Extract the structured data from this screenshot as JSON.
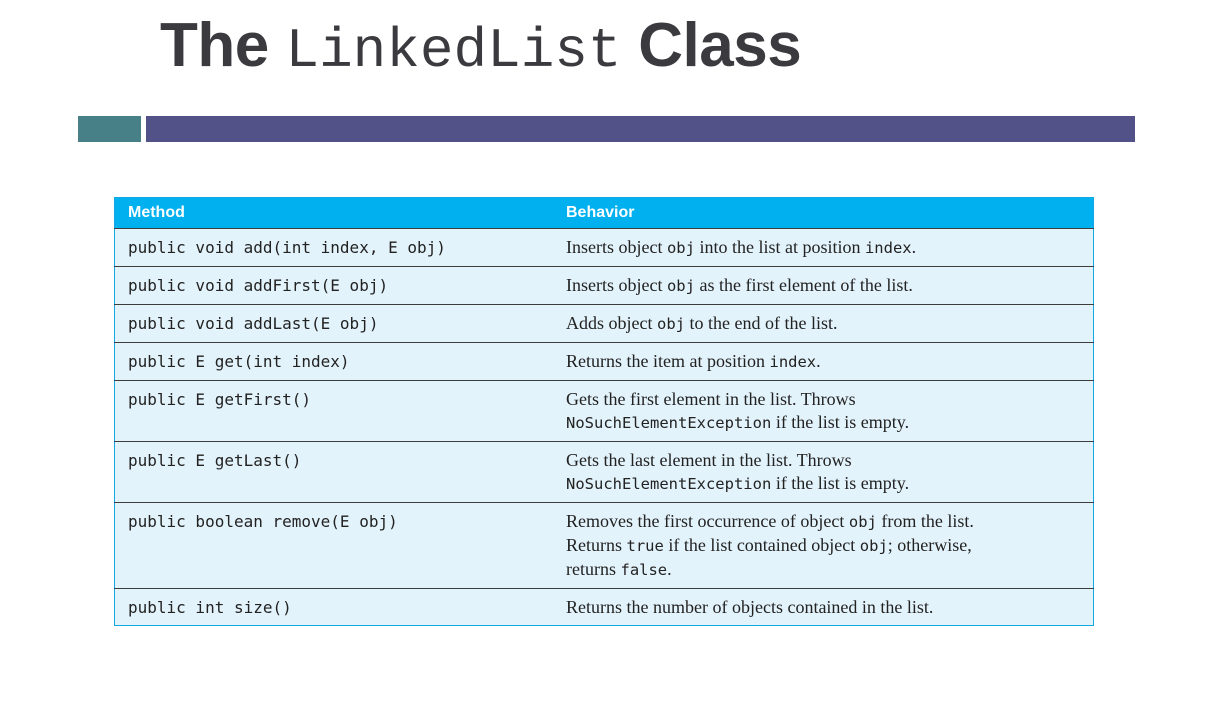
{
  "title": {
    "prefix": "The",
    "code": "LinkedList",
    "suffix": "Class"
  },
  "table": {
    "headers": {
      "method": "Method",
      "behavior": "Behavior"
    },
    "rows": [
      {
        "method": "public void add(int index, E obj)",
        "behavior": [
          {
            "t": "Inserts object "
          },
          {
            "c": "obj"
          },
          {
            "t": " into the list at position "
          },
          {
            "c": "index"
          },
          {
            "t": "."
          }
        ]
      },
      {
        "method": "public void addFirst(E obj)",
        "behavior": [
          {
            "t": "Inserts object "
          },
          {
            "c": "obj"
          },
          {
            "t": " as the first element of the list."
          }
        ]
      },
      {
        "method": "public void addLast(E obj)",
        "behavior": [
          {
            "t": "Adds object "
          },
          {
            "c": "obj"
          },
          {
            "t": " to the end of the list."
          }
        ]
      },
      {
        "method": "public E get(int index)",
        "behavior": [
          {
            "t": "Returns the item at position "
          },
          {
            "c": "index"
          },
          {
            "t": "."
          }
        ]
      },
      {
        "method": "public E getFirst()",
        "behavior": [
          {
            "t": "Gets the first element in the list. Throws "
          },
          {
            "br": true
          },
          {
            "c": "NoSuchElementException"
          },
          {
            "t": " if the list is empty."
          }
        ]
      },
      {
        "method": "public E getLast()",
        "behavior": [
          {
            "t": "Gets the last element in the list. Throws "
          },
          {
            "br": true
          },
          {
            "c": "NoSuchElementException"
          },
          {
            "t": " if the list is empty."
          }
        ]
      },
      {
        "method": "public boolean remove(E obj)",
        "behavior": [
          {
            "t": "Removes the first occurrence of object "
          },
          {
            "c": "obj"
          },
          {
            "t": " from the list."
          },
          {
            "br": true
          },
          {
            "t": "Returns "
          },
          {
            "c": "true"
          },
          {
            "t": " if the list contained object "
          },
          {
            "c": "obj"
          },
          {
            "t": "; otherwise,"
          },
          {
            "br": true
          },
          {
            "t": "returns "
          },
          {
            "c": "false"
          },
          {
            "t": "."
          }
        ]
      },
      {
        "method": "public int size()",
        "behavior": [
          {
            "t": "Returns the number of objects contained in the list."
          }
        ]
      }
    ]
  },
  "colors": {
    "title": "#3b3b3f",
    "bar_left": "#478086",
    "bar_right": "#525188",
    "table_header": "#00b0ef",
    "table_row": "#e3f3fb"
  }
}
